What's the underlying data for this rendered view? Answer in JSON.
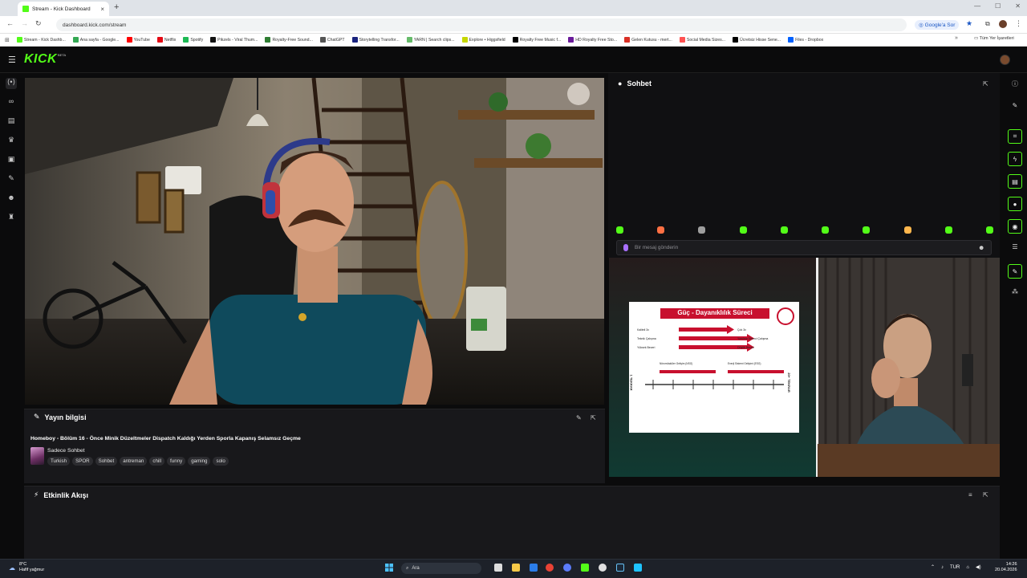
{
  "browser": {
    "tab_title": "Stream - Kick Dashboard",
    "tab_close": "×",
    "new_tab": "+",
    "url": "dashboard.kick.com/stream",
    "google_sor": "Google'a Sor",
    "bookmarks": [
      {
        "label": "Stream - Kick Dashb...",
        "color": "#53fc18"
      },
      {
        "label": "Ana sayfa - Google...",
        "color": "#34a853"
      },
      {
        "label": "YouTube",
        "color": "#ff0000"
      },
      {
        "label": "Netflix",
        "color": "#e50914"
      },
      {
        "label": "Spotify",
        "color": "#1db954"
      },
      {
        "label": "Pikzels - Viral Thum...",
        "color": "#111111"
      },
      {
        "label": "Royalty-Free Sound...",
        "color": "#2e7d32"
      },
      {
        "label": "ChatGPT",
        "color": "#555555"
      },
      {
        "label": "Storytelling Transfor...",
        "color": "#1a237e"
      },
      {
        "label": "YARN | Search clips...",
        "color": "#66bb6a"
      },
      {
        "label": "Explore • Higgsfield",
        "color": "#c6d700"
      },
      {
        "label": "Royalty Free Music f...",
        "color": "#000000"
      },
      {
        "label": "HD Royalty Free Sto...",
        "color": "#6a1b9a"
      },
      {
        "label": "Gelen Kutusu - mert...",
        "color": "#d93025"
      },
      {
        "label": "Social Media Sizes...",
        "color": "#ff5252"
      },
      {
        "label": "Ücretsiz Hisse Sene...",
        "color": "#000000"
      },
      {
        "label": "Files - Dropbox",
        "color": "#0061ff"
      }
    ],
    "bookmarks_more": "»",
    "all_bookmarks": "Tüm Yer İşaretleri"
  },
  "kick": {
    "logo": "KICK",
    "beta": "BETA"
  },
  "stream_info": {
    "header": "Yayın bilgisi",
    "title": "Homeboy - Bölüm 16 - Önce Minik Düzeltmeler Dispatch Kaldığı Yerden Sporla Kapanış Selamsız Geçme",
    "category": "Sadece Sohbet",
    "tags": [
      "Turkish",
      "SPOR",
      "Sohbet",
      "antreman",
      "chill",
      "funny",
      "gaming",
      "solo"
    ]
  },
  "activity": {
    "header": "Etkinlik Akışı"
  },
  "chat": {
    "header": "Sohbet",
    "input_placeholder": "Bir mesaj gönderin",
    "emote_colors": [
      "#53fc18",
      "#ff7043",
      "#9e9e9e",
      "#53fc18",
      "#53fc18",
      "#53fc18",
      "#53fc18",
      "#ffb74d",
      "#53fc18",
      "#53fc18"
    ]
  },
  "slide": {
    "title": "Güç - Dayanıklılık Süreci",
    "rows": [
      {
        "left": "Kaliteli 3x",
        "right": "Çok 3x"
      },
      {
        "left": "Teknik Çalışma",
        "right": "Yorulma Direnci Çalışma"
      },
      {
        "left": "Yüksek Beceri",
        "right": "Düşük Beceri"
      }
    ],
    "nsg": "Nöromüsküler Gelişim (NSG)",
    "esg": "Enerji Sistemi Gelişimi (ESG)",
    "left_axis": "1 TEKRAR",
    "right_axis": "20+ TEKRAR"
  },
  "taskbar": {
    "temp": "8°C",
    "weather": "Hafif yağmur",
    "search": "Ara",
    "lang": "TUR",
    "time": "14:26",
    "date": "20.04.2026"
  }
}
